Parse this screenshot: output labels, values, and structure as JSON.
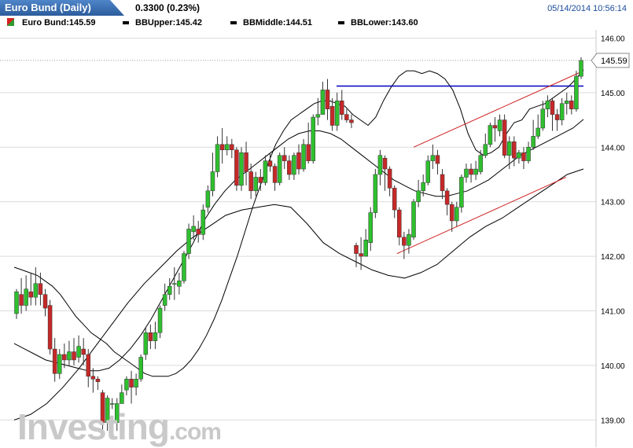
{
  "header": {
    "title": "Euro Bund (Daily)",
    "change": "0.3300 (0.23%)",
    "timestamp": "05/14/2014 10:56:14"
  },
  "legend": {
    "items": [
      {
        "label": "Euro Bund:145.59"
      },
      {
        "label": "BBUpper:145.42"
      },
      {
        "label": "BBMiddle:144.51"
      },
      {
        "label": "BBLower:143.60"
      }
    ]
  },
  "watermark": {
    "brand": "Investing",
    "suffix": ".com"
  },
  "colors": {
    "up": "#2fbf2f",
    "down": "#c62828",
    "band": "#000000",
    "resistance": "#0000c0",
    "channel": "#d02020",
    "grid": "#dcdcdc"
  },
  "chart_data": {
    "type": "candlestick",
    "ylim": [
      138.5,
      146.05
    ],
    "y_ticks": [
      "146.00",
      "145.00",
      "144.00",
      "143.00",
      "142.00",
      "141.00",
      "140.00",
      "139.00"
    ],
    "last_price_label": "145.59",
    "last_price": 145.59,
    "candles": [
      [
        140.95,
        141.35,
        141.4,
        140.85
      ],
      [
        141.3,
        141.1,
        141.6,
        140.95
      ],
      [
        141.1,
        141.4,
        141.65,
        141.0
      ],
      [
        141.35,
        141.25,
        141.7,
        141.1
      ],
      [
        141.25,
        141.5,
        141.8,
        141.1
      ],
      [
        141.5,
        141.3,
        141.7,
        141.1
      ],
      [
        141.3,
        141.05,
        141.4,
        140.9
      ],
      [
        141.1,
        140.3,
        141.2,
        140.2
      ],
      [
        140.3,
        139.85,
        140.5,
        139.7
      ],
      [
        139.85,
        140.2,
        140.3,
        139.75
      ],
      [
        140.2,
        140.1,
        140.4,
        139.95
      ],
      [
        140.1,
        140.25,
        140.45,
        140.0
      ],
      [
        140.25,
        140.1,
        140.5,
        140.0
      ],
      [
        140.15,
        140.35,
        140.55,
        140.05
      ],
      [
        140.3,
        140.2,
        140.5,
        140.0
      ],
      [
        140.2,
        139.8,
        140.3,
        139.6
      ],
      [
        139.8,
        139.75,
        139.95,
        139.5
      ],
      [
        139.75,
        139.7,
        139.8,
        139.55
      ],
      [
        139.5,
        138.95,
        139.55,
        138.7
      ],
      [
        138.95,
        139.4,
        139.45,
        138.8
      ],
      [
        139.3,
        139.3,
        139.4,
        139.2
      ],
      [
        138.95,
        139.3,
        139.4,
        138.8
      ],
      [
        139.3,
        139.5,
        139.65,
        139.3
      ],
      [
        139.55,
        139.75,
        139.8,
        139.45
      ],
      [
        139.75,
        139.6,
        139.9,
        139.3
      ],
      [
        139.6,
        139.75,
        139.85,
        139.45
      ],
      [
        139.75,
        140.15,
        140.2,
        139.7
      ],
      [
        140.2,
        140.6,
        140.7,
        140.1
      ],
      [
        140.6,
        140.45,
        140.75,
        140.3
      ],
      [
        140.45,
        140.6,
        140.8,
        140.3
      ],
      [
        140.6,
        141.05,
        141.1,
        140.5
      ],
      [
        141.1,
        141.3,
        141.5,
        141.0
      ],
      [
        141.3,
        141.45,
        141.6,
        141.2
      ],
      [
        141.5,
        141.5,
        141.8,
        141.2
      ],
      [
        141.45,
        141.55,
        141.7,
        141.3
      ],
      [
        141.55,
        142.05,
        142.1,
        141.5
      ],
      [
        142.05,
        142.5,
        142.6,
        141.95
      ],
      [
        142.45,
        142.55,
        142.75,
        142.3
      ],
      [
        142.5,
        142.4,
        142.65,
        142.25
      ],
      [
        142.4,
        142.85,
        142.95,
        142.3
      ],
      [
        142.9,
        143.2,
        143.3,
        142.8
      ],
      [
        143.2,
        143.55,
        143.9,
        143.1
      ],
      [
        143.55,
        144.05,
        144.2,
        143.45
      ],
      [
        144.05,
        143.95,
        144.35,
        143.7
      ],
      [
        143.95,
        144.05,
        144.2,
        143.85
      ],
      [
        144.05,
        143.95,
        144.15,
        143.8
      ],
      [
        143.95,
        143.3,
        144.0,
        143.2
      ],
      [
        143.3,
        143.9,
        144.0,
        143.2
      ],
      [
        143.9,
        143.55,
        144.1,
        143.3
      ],
      [
        143.55,
        143.2,
        143.7,
        143.05
      ],
      [
        143.2,
        143.45,
        143.55,
        143.1
      ],
      [
        143.45,
        143.35,
        143.6,
        143.2
      ],
      [
        143.35,
        143.75,
        143.85,
        143.3
      ],
      [
        143.75,
        143.65,
        143.9,
        143.55
      ],
      [
        143.65,
        143.35,
        143.7,
        143.2
      ],
      [
        143.35,
        143.85,
        143.9,
        143.3
      ],
      [
        143.85,
        143.75,
        144.0,
        143.6
      ],
      [
        143.75,
        143.5,
        143.85,
        143.4
      ],
      [
        143.5,
        143.85,
        143.9,
        143.4
      ],
      [
        143.9,
        143.6,
        144.05,
        143.5
      ],
      [
        143.6,
        144.05,
        144.15,
        143.55
      ],
      [
        144.05,
        143.75,
        144.45,
        143.7
      ],
      [
        143.75,
        144.55,
        144.6,
        143.7
      ],
      [
        144.55,
        144.6,
        144.9,
        144.4
      ],
      [
        144.6,
        145.05,
        145.2,
        144.6
      ],
      [
        145.05,
        144.7,
        145.25,
        144.5
      ],
      [
        144.75,
        144.4,
        144.9,
        144.3
      ],
      [
        144.4,
        144.85,
        145.0,
        144.3
      ],
      [
        144.85,
        144.6,
        145.05,
        144.5
      ],
      [
        144.6,
        144.5,
        144.7,
        144.45
      ],
      [
        144.5,
        144.45,
        144.6,
        144.35
      ],
      [
        142.2,
        142.05,
        142.25,
        141.8
      ],
      [
        142.05,
        142.0,
        142.35,
        141.75
      ],
      [
        142.0,
        142.3,
        142.5,
        142.0
      ],
      [
        142.25,
        142.8,
        142.9,
        142.1
      ],
      [
        142.8,
        143.5,
        143.6,
        142.7
      ],
      [
        143.5,
        143.85,
        143.95,
        143.3
      ],
      [
        143.8,
        143.6,
        143.85,
        143.2
      ],
      [
        143.6,
        143.25,
        143.65,
        143.1
      ],
      [
        143.25,
        142.85,
        143.3,
        142.7
      ],
      [
        142.85,
        142.35,
        142.9,
        142.2
      ],
      [
        142.35,
        142.2,
        142.45,
        141.95
      ],
      [
        142.2,
        142.4,
        142.5,
        142.05
      ],
      [
        142.35,
        143.0,
        143.05,
        142.3
      ],
      [
        143.0,
        143.2,
        143.4,
        142.9
      ],
      [
        143.2,
        143.35,
        143.5,
        143.1
      ],
      [
        143.35,
        143.75,
        143.85,
        143.3
      ],
      [
        143.75,
        143.85,
        144.05,
        143.6
      ],
      [
        143.85,
        143.7,
        143.95,
        143.5
      ],
      [
        143.5,
        143.2,
        143.6,
        143.05
      ],
      [
        143.2,
        142.95,
        143.25,
        142.75
      ],
      [
        142.95,
        142.65,
        143.0,
        142.45
      ],
      [
        142.65,
        142.9,
        143.0,
        142.55
      ],
      [
        142.9,
        143.45,
        143.5,
        142.8
      ],
      [
        143.45,
        143.6,
        143.7,
        143.35
      ],
      [
        143.6,
        143.5,
        143.7,
        143.35
      ],
      [
        143.5,
        143.6,
        143.75,
        143.4
      ],
      [
        143.55,
        143.85,
        143.95,
        143.5
      ],
      [
        143.85,
        144.05,
        144.25,
        143.8
      ],
      [
        144.05,
        144.4,
        144.45,
        144.0
      ],
      [
        144.4,
        144.35,
        144.55,
        144.1
      ],
      [
        144.3,
        144.5,
        144.6,
        144.2
      ],
      [
        144.5,
        143.85,
        144.6,
        143.8
      ],
      [
        143.85,
        144.1,
        144.2,
        143.6
      ],
      [
        144.1,
        143.8,
        144.2,
        143.65
      ],
      [
        143.8,
        143.9,
        143.95,
        143.7
      ],
      [
        143.9,
        143.75,
        144.0,
        143.6
      ],
      [
        143.75,
        144.0,
        144.1,
        143.7
      ],
      [
        144.0,
        144.2,
        144.5,
        143.95
      ],
      [
        144.2,
        144.35,
        144.6,
        144.15
      ],
      [
        144.35,
        144.7,
        144.85,
        144.3
      ],
      [
        144.7,
        144.85,
        144.95,
        144.55
      ],
      [
        144.85,
        144.6,
        144.9,
        144.3
      ],
      [
        144.6,
        144.5,
        144.7,
        144.3
      ],
      [
        144.5,
        144.8,
        144.9,
        144.4
      ],
      [
        144.8,
        144.85,
        145.0,
        144.6
      ],
      [
        144.85,
        144.7,
        144.95,
        144.6
      ],
      [
        144.7,
        145.3,
        145.4,
        144.65
      ],
      [
        145.3,
        145.59,
        145.65,
        145.25
      ]
    ],
    "bb_upper": [
      141.8,
      141.75,
      141.7,
      141.65,
      141.55,
      141.45,
      141.3,
      141.1,
      140.9,
      140.75,
      140.6,
      140.5,
      140.4,
      140.25,
      140.15,
      140.05,
      139.95,
      139.85,
      139.8,
      139.8,
      139.8,
      139.85,
      139.95,
      140.1,
      140.3,
      140.55,
      140.85,
      141.2,
      141.6,
      142.0,
      142.45,
      142.9,
      143.3,
      143.7,
      144.05,
      144.3,
      144.5,
      144.6,
      144.7,
      144.8,
      144.85,
      144.85,
      144.8,
      144.75,
      144.6,
      144.5,
      144.4,
      144.55,
      144.85,
      145.1,
      145.3,
      145.4,
      145.4,
      145.35,
      145.4,
      145.35,
      145.25,
      145.05,
      144.7,
      144.25,
      143.95,
      143.85,
      143.9,
      144.0,
      144.25,
      144.45,
      144.5,
      144.7,
      144.75,
      144.8,
      144.9,
      145.0,
      145.1,
      145.25,
      145.42
    ],
    "bb_middle": [
      140.4,
      140.3,
      140.2,
      140.1,
      140.05,
      140.0,
      139.95,
      139.9,
      139.9,
      139.95,
      140.1,
      140.3,
      140.55,
      140.85,
      141.2,
      141.55,
      141.9,
      142.25,
      142.65,
      142.95,
      143.2,
      143.4,
      143.55,
      143.7,
      143.85,
      144.0,
      144.15,
      144.25,
      144.3,
      144.3,
      144.25,
      144.15,
      144.0,
      143.85,
      143.7,
      143.55,
      143.4,
      143.3,
      143.2,
      143.15,
      143.1,
      143.1,
      143.15,
      143.2,
      143.3,
      143.4,
      143.55,
      143.7,
      143.85,
      143.95,
      144.05,
      144.15,
      144.25,
      144.35,
      144.51
    ],
    "bb_lower": [
      139.0,
      139.1,
      139.3,
      139.6,
      139.95,
      140.35,
      140.75,
      141.15,
      141.5,
      141.8,
      142.1,
      142.35,
      142.55,
      142.75,
      142.85,
      142.9,
      142.95,
      142.9,
      142.6,
      142.25,
      142.05,
      141.9,
      141.75,
      141.65,
      141.6,
      141.7,
      141.85,
      142.1,
      142.35,
      142.55,
      142.7,
      142.9,
      143.1,
      143.3,
      143.5,
      143.6
    ]
  }
}
